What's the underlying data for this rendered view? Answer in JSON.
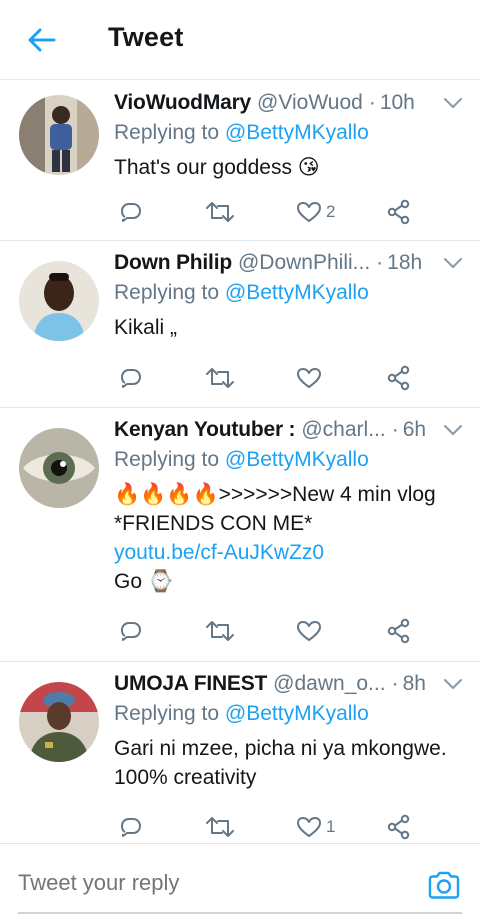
{
  "header": {
    "title": "Tweet"
  },
  "icons": {
    "back": "arrow-left-icon",
    "caret": "chevron-down-icon",
    "reply": "reply-icon",
    "retweet": "retweet-icon",
    "like": "heart-icon",
    "share": "share-icon",
    "camera": "camera-icon"
  },
  "colors": {
    "accent": "#1da1f2",
    "muted": "#657786",
    "text": "#14171a",
    "divider": "#e1e8ed"
  },
  "tweets": [
    {
      "name": "VioWuodMary",
      "handle": "@VioWuod",
      "sep": "·",
      "time": "10h",
      "reply_prefix": "Replying to ",
      "reply_to": "@BettyMKyallo",
      "text": "That's our goddess 😘",
      "link": "",
      "extra": "",
      "likes": "2"
    },
    {
      "name": "Down Philip",
      "handle": "@DownPhili...",
      "sep": "·",
      "time": "18h",
      "reply_prefix": "Replying to ",
      "reply_to": "@BettyMKyallo",
      "text": "Kikali „",
      "link": "",
      "extra": "",
      "likes": ""
    },
    {
      "name": "Kenyan Youtuber :",
      "handle": "@charl...",
      "sep": "·",
      "time": "6h",
      "reply_prefix": "Replying to ",
      "reply_to": "@BettyMKyallo",
      "text": "🔥🔥🔥🔥>>>>>>New 4 min vlog *FRIENDS CON ME*",
      "link": "youtu.be/cf-AuJKwZz0",
      "extra": "Go ⌚",
      "likes": ""
    },
    {
      "name": "UMOJA FINEST",
      "handle": "@dawn_o...",
      "sep": "·",
      "time": "8h",
      "reply_prefix": "Replying to ",
      "reply_to": "@BettyMKyallo",
      "text": "Gari ni mzee, picha ni ya mkongwe. 100% creativity",
      "link": "",
      "extra": "",
      "likes": "1"
    }
  ],
  "reply_bar": {
    "placeholder": "Tweet your reply"
  }
}
